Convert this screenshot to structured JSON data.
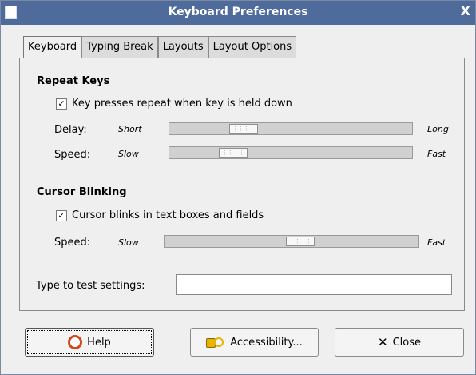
{
  "window": {
    "title": "Keyboard Preferences",
    "close_glyph": "X"
  },
  "tabs": [
    {
      "label": "Keyboard",
      "active": true
    },
    {
      "label": "Typing Break",
      "active": false
    },
    {
      "label": "Layouts",
      "active": false
    },
    {
      "label": "Layout Options",
      "active": false
    }
  ],
  "repeat_keys": {
    "heading": "Repeat Keys",
    "checkbox_label": "Key presses repeat when key is held down",
    "checked": true,
    "delay_label": "Delay:",
    "delay_min": "Short",
    "delay_max": "Long",
    "delay_value": 0.28,
    "speed_label": "Speed:",
    "speed_min": "Slow",
    "speed_max": "Fast",
    "speed_value": 0.23
  },
  "cursor_blinking": {
    "heading": "Cursor Blinking",
    "checkbox_label": "Cursor blinks in text boxes and fields",
    "checked": true,
    "speed_label": "Speed:",
    "speed_min": "Slow",
    "speed_max": "Fast",
    "speed_value": 0.54
  },
  "test": {
    "label": "Type to test settings:",
    "value": ""
  },
  "buttons": {
    "help": "Help",
    "accessibility": "Accessibility...",
    "close": "Close"
  },
  "icons": {
    "help": "help-lifebuoy-icon",
    "accessibility": "accessibility-icon",
    "close": "close-x-icon"
  }
}
